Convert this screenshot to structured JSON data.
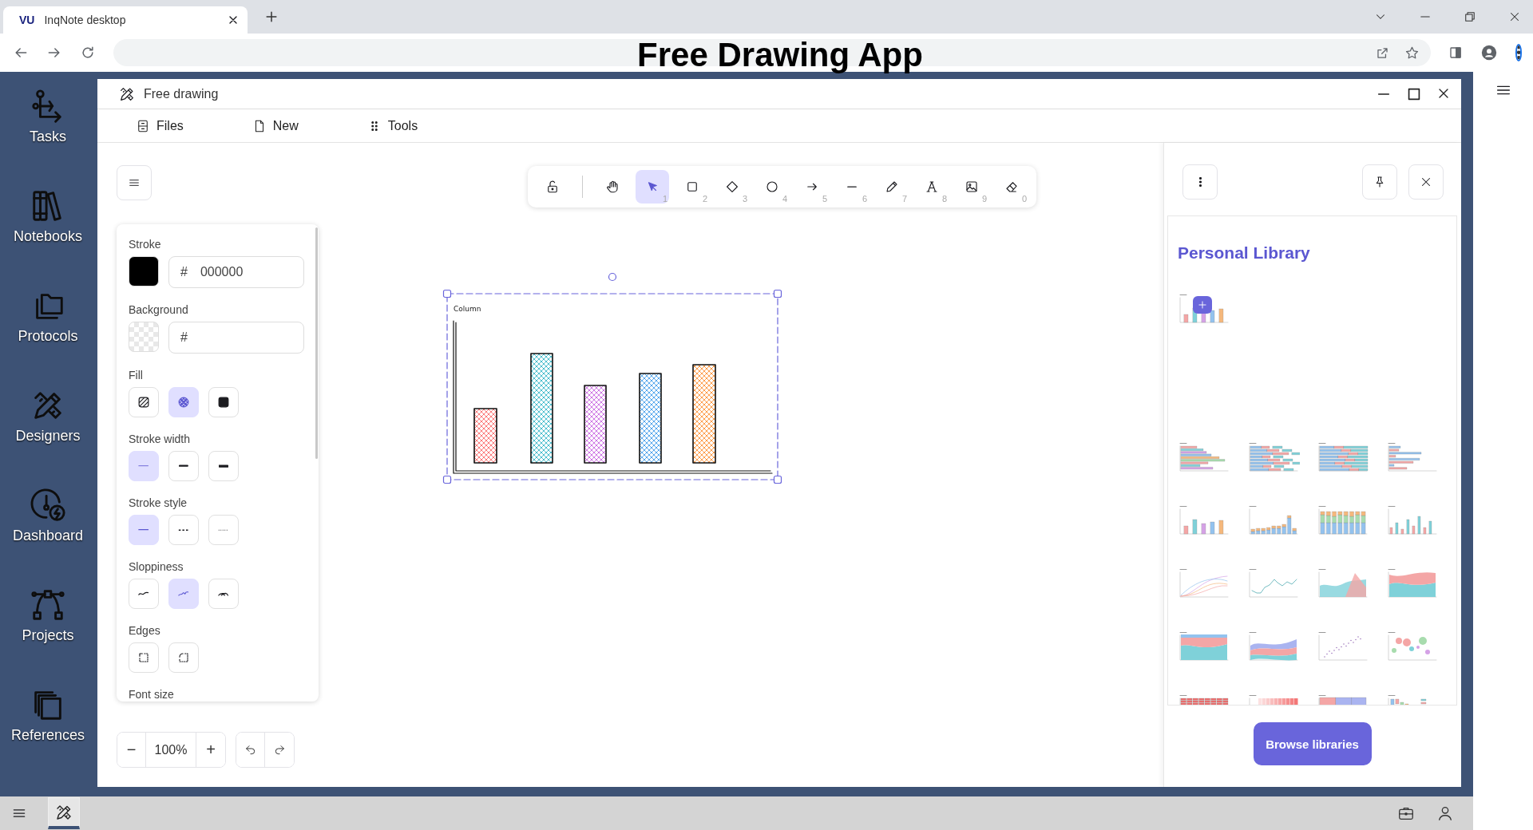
{
  "browser": {
    "tab": {
      "logo": "VU",
      "title": "InqNote desktop"
    },
    "banner": "Free Drawing App"
  },
  "nav": [
    {
      "kind": "tasks",
      "label": "Tasks"
    },
    {
      "kind": "notebooks",
      "label": "Notebooks"
    },
    {
      "kind": "protocols",
      "label": "Protocols"
    },
    {
      "kind": "designers",
      "label": "Designers"
    },
    {
      "kind": "dashboard",
      "label": "Dashboard"
    },
    {
      "kind": "projects",
      "label": "Projects"
    },
    {
      "kind": "references",
      "label": "References"
    }
  ],
  "window": {
    "title": "Free drawing",
    "menu": [
      {
        "kind": "files",
        "label": "Files"
      },
      {
        "kind": "new",
        "label": "New"
      },
      {
        "kind": "tools",
        "label": "Tools"
      }
    ]
  },
  "toolbar": [
    {
      "kind": "lock",
      "selected": false
    },
    {
      "kind": "hand",
      "selected": false
    },
    {
      "kind": "selection",
      "shortcut": "1",
      "selected": true
    },
    {
      "kind": "rectangle",
      "shortcut": "2",
      "selected": false
    },
    {
      "kind": "diamond",
      "shortcut": "3",
      "selected": false
    },
    {
      "kind": "ellipse",
      "shortcut": "4",
      "selected": false
    },
    {
      "kind": "arrow",
      "shortcut": "5",
      "selected": false
    },
    {
      "kind": "line",
      "shortcut": "6",
      "selected": false
    },
    {
      "kind": "pencil",
      "shortcut": "7",
      "selected": false
    },
    {
      "kind": "text",
      "shortcut": "8",
      "selected": false
    },
    {
      "kind": "image",
      "shortcut": "9",
      "selected": false
    },
    {
      "kind": "eraser",
      "shortcut": "0",
      "selected": false
    }
  ],
  "properties": [
    {
      "label": "Stroke",
      "kind": "color",
      "prefix": "#",
      "value": "000000"
    },
    {
      "label": "Background",
      "kind": "color",
      "prefix": "#"
    },
    {
      "label": "Fill",
      "kind": "options",
      "options": [
        {
          "kind": "hatch",
          "selected": false
        },
        {
          "kind": "cross-hatch",
          "selected": true
        },
        {
          "kind": "solid",
          "selected": false
        }
      ]
    },
    {
      "label": "Stroke width",
      "kind": "options",
      "options": [
        {
          "kind": "thin",
          "selected": true
        },
        {
          "kind": "medium",
          "selected": false
        },
        {
          "kind": "bold",
          "selected": false
        }
      ]
    },
    {
      "label": "Stroke style",
      "kind": "options",
      "options": [
        {
          "kind": "solid-line",
          "selected": true
        },
        {
          "kind": "dashed",
          "selected": false
        },
        {
          "kind": "dotted",
          "selected": false
        }
      ]
    },
    {
      "label": "Sloppiness",
      "kind": "options",
      "options": [
        {
          "kind": "architect",
          "selected": false
        },
        {
          "kind": "artist",
          "selected": true
        },
        {
          "kind": "cartoonist",
          "selected": false
        }
      ]
    },
    {
      "label": "Edges",
      "kind": "options",
      "options": [
        {
          "kind": "sharp",
          "selected": false
        },
        {
          "kind": "round",
          "selected": false
        }
      ]
    },
    {
      "label": "Font size",
      "kind": "heading"
    }
  ],
  "zoom": {
    "out": "−",
    "value": "100%",
    "in": "+"
  },
  "canvas": {
    "chart_title": "Column"
  },
  "library": {
    "title": "Personal Library",
    "personal": [
      {
        "kind": "column"
      }
    ],
    "items": [
      {
        "kind": "bar"
      },
      {
        "kind": "stacked-bar"
      },
      {
        "kind": "percent-bar"
      },
      {
        "kind": "grouped-bar"
      },
      {
        "kind": "column"
      },
      {
        "kind": "stacked-column"
      },
      {
        "kind": "percent-column"
      },
      {
        "kind": "grouped-column"
      },
      {
        "kind": "multi-line"
      },
      {
        "kind": "line"
      },
      {
        "kind": "area"
      },
      {
        "kind": "stacked-area"
      },
      {
        "kind": "percent-area"
      },
      {
        "kind": "streamgraph"
      },
      {
        "kind": "scatter"
      },
      {
        "kind": "bubble"
      },
      {
        "kind": "heatmap"
      },
      {
        "kind": "heat-strip"
      },
      {
        "kind": "treemap"
      },
      {
        "kind": "waterfall"
      }
    ],
    "button": "Browse libraries"
  },
  "taskbar": {
    "apps": [
      {
        "kind": "drawing",
        "selected": true
      }
    ]
  }
}
